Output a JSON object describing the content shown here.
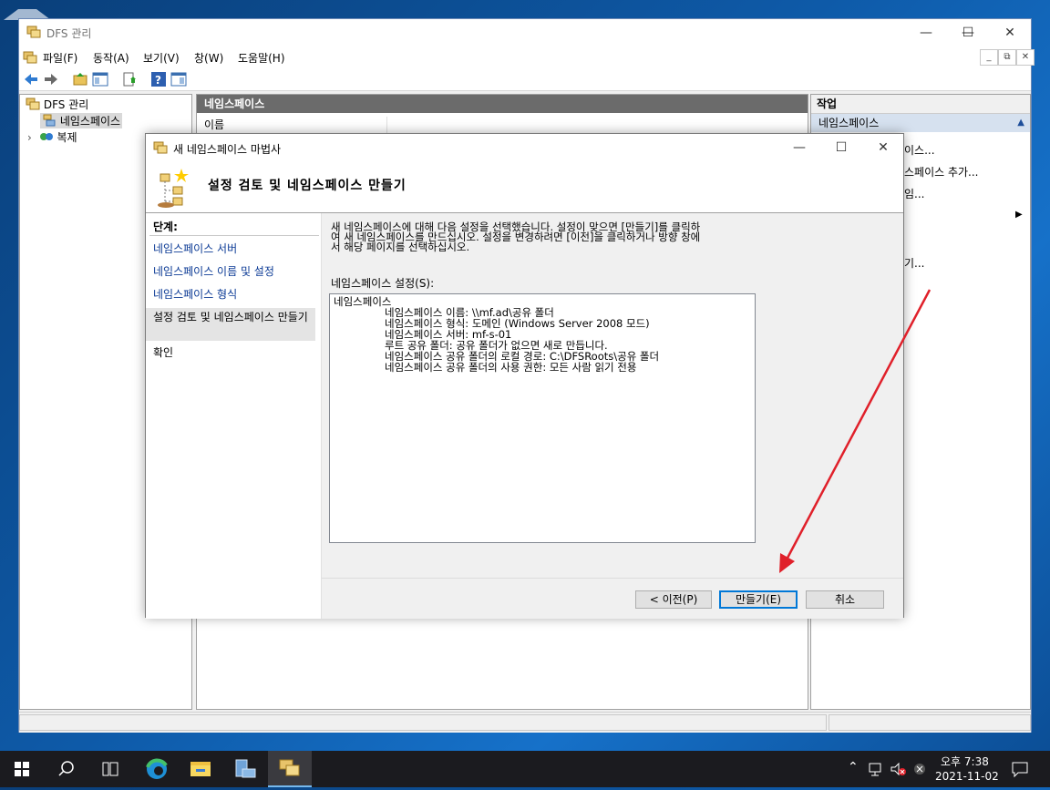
{
  "mmc": {
    "title": "DFS 관리",
    "menu": [
      "파일(F)",
      "동작(A)",
      "보기(V)",
      "창(W)",
      "도움말(H)"
    ],
    "tree": {
      "root": "DFS 관리",
      "child1": "네임스페이스",
      "child2": "복제"
    },
    "center": {
      "header": "네임스페이스",
      "column": "이름"
    },
    "actions": {
      "header": "작업",
      "subheader": "네임스페이스",
      "items": [
        "이스...",
        "스페이스 추가...",
        "임...",
        "기..."
      ]
    }
  },
  "wizard": {
    "title": "새 네임스페이스 마법사",
    "heading": "설정 검토 및 네임스페이스 만들기",
    "steps_title": "단계:",
    "steps": [
      "네임스페이스 서버",
      "네임스페이스 이름 및 설정",
      "네임스페이스 형식",
      "설정 검토 및 네임스페이스 만들기",
      "확인"
    ],
    "intro_lines": [
      "새 네임스페이스에 대해 다음 설정을 선택했습니다. 설정이 맞으면 [만들기]를 클릭하",
      "여 새 네임스페이스를 만드십시오. 설정을 변경하려면 [이전]을 클릭하거나 방향 창에",
      "서 해당 페이지를 선택하십시오."
    ],
    "settings_label": "네임스페이스 설정(S):",
    "settings": {
      "root": "네임스페이스",
      "lines": [
        "네임스페이스 이름: \\\\mf.ad\\공유 폴더",
        "네임스페이스 형식: 도메인 (Windows Server 2008 모드)",
        "네임스페이스 서버: mf-s-01",
        "루트 공유 폴더:  공유 폴더가 없으면 새로 만듭니다.",
        "네임스페이스 공유 폴더의 로컬 경로: C:\\DFSRoots\\공유 폴더",
        "네임스페이스 공유 폴더의 사용 권한: 모든 사람 읽기 전용"
      ]
    },
    "buttons": {
      "back": "< 이전(P)",
      "create": "만들기(E)",
      "cancel": "취소"
    }
  },
  "taskbar": {
    "time": "오후 7:38",
    "date": "2021-11-02"
  },
  "colors": {
    "accent": "#0078d7",
    "annotation_arrow": "#e0202a",
    "link": "#0b3a95"
  }
}
